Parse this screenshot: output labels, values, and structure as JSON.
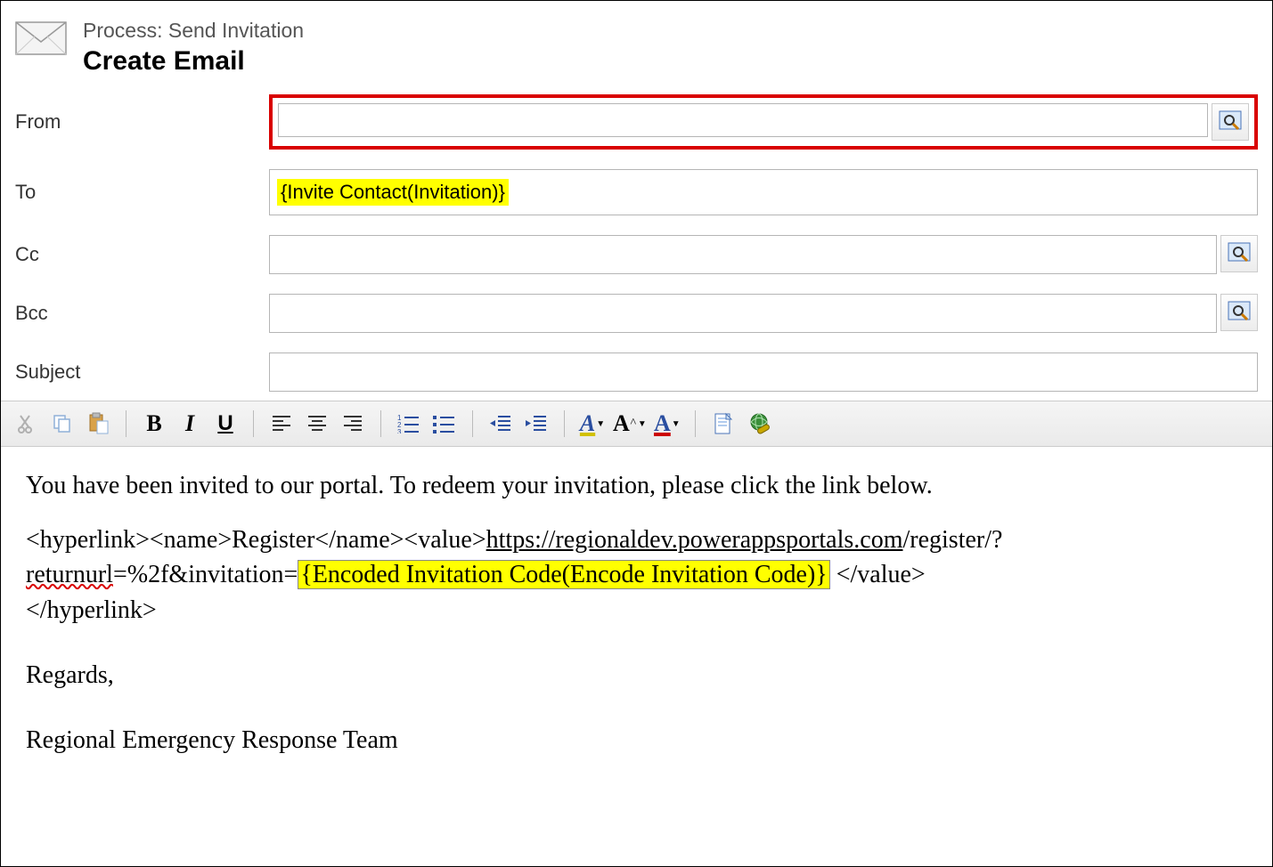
{
  "header": {
    "process_line": "Process: Send Invitation",
    "page_title": "Create Email"
  },
  "fields": {
    "from_label": "From",
    "from_value": "",
    "to_label": "To",
    "to_chip": "{Invite Contact(Invitation)}",
    "cc_label": "Cc",
    "cc_value": "",
    "bcc_label": "Bcc",
    "bcc_value": "",
    "subject_label": "Subject",
    "subject_value": ""
  },
  "toolbar": {
    "cut": "Cut",
    "copy": "Copy",
    "paste": "Paste",
    "bold": "B",
    "italic": "I",
    "underline": "U",
    "align_left": "Align Left",
    "align_center": "Align Center",
    "align_right": "Align Right",
    "ol": "Numbered List",
    "ul": "Bulleted List",
    "outdent": "Decrease Indent",
    "indent": "Increase Indent",
    "highlight": "Highlight Color",
    "font_size": "Font Size",
    "font_color": "Font Color",
    "insert_template": "Insert Template",
    "insert_link": "Insert Hyperlink"
  },
  "body": {
    "line1": "You have been invited to our portal. To redeem your invitation, please click the link below.",
    "hl_open1": "<hyperlink><name>Register</name><value>",
    "url_part1": "https://regionaldev.powerappsportals.com",
    "url_part2": "/register/?",
    "url_word_returnurl": "returnurl",
    "url_part3": "=%2f&invitation=",
    "token": "{Encoded Invitation Code(Encode Invitation Code)}",
    "hl_close_value": " </value>",
    "hl_close_hyperlink": "</hyperlink>",
    "regards": "Regards,",
    "signature": "Regional Emergency Response Team"
  }
}
